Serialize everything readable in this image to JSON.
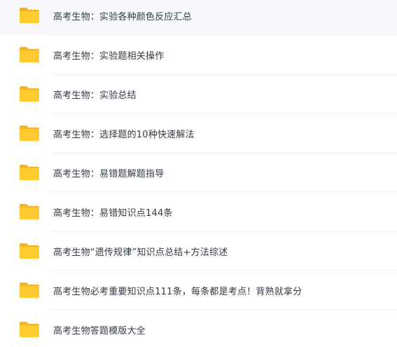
{
  "folders": [
    {
      "name": "高考生物：实验各种颜色反应汇总",
      "icon": "folder-icon"
    },
    {
      "name": "高考生物：实验题相关操作",
      "icon": "folder-icon"
    },
    {
      "name": "高考生物：实验总结",
      "icon": "folder-icon"
    },
    {
      "name": "高考生物：选择题的10种快速解法",
      "icon": "folder-icon"
    },
    {
      "name": "高考生物：易错题解题指导",
      "icon": "folder-icon"
    },
    {
      "name": "高考生物：易错知识点144条",
      "icon": "folder-icon"
    },
    {
      "name": "高考生物“遗传规律”知识点总结+方法综述",
      "icon": "folder-icon"
    },
    {
      "name": "高考生物必考重要知识点111条，每条都是考点！背熟就拿分",
      "icon": "folder-icon"
    },
    {
      "name": "高考生物答题模版大全",
      "icon": "folder-icon"
    }
  ],
  "colors": {
    "folder_back": "#f5b324",
    "folder_front": "#ffc930",
    "text": "#333a45",
    "hover_bg": "#f7f8fb"
  }
}
